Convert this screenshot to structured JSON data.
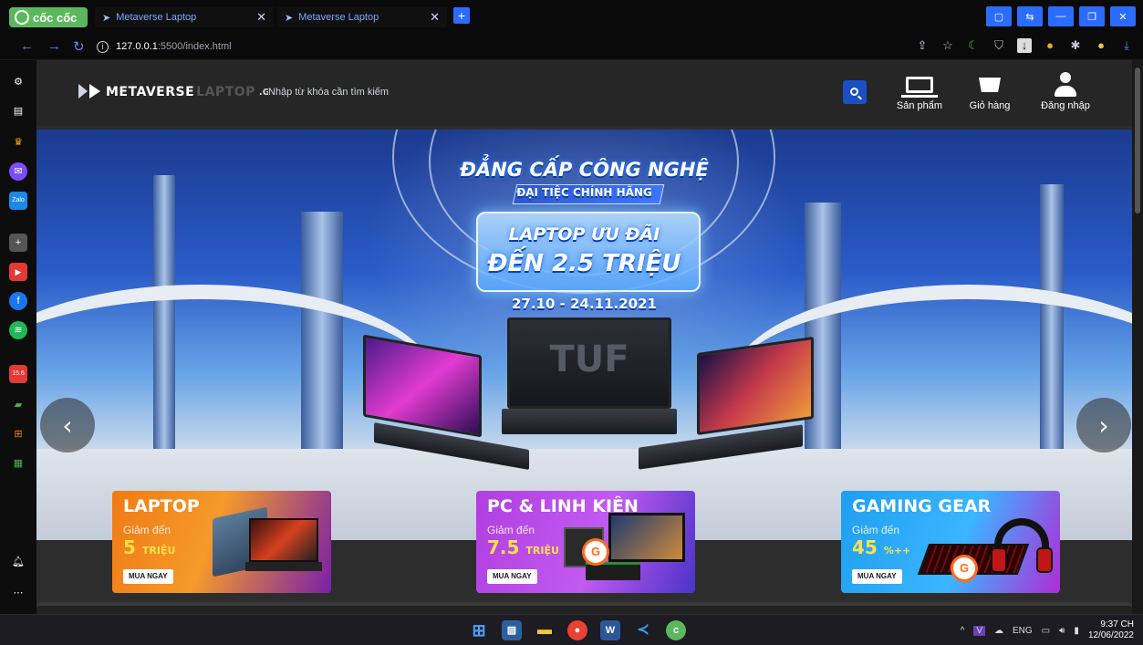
{
  "browser": {
    "brand": "cốc cốc",
    "tabs": [
      {
        "title": "Metaverse Laptop"
      },
      {
        "title": "Metaverse Laptop"
      }
    ],
    "url_host": "127.0.0.1",
    "url_path": ":5500/index.html"
  },
  "site": {
    "logo_a": "METAVERSE",
    "logo_b": "LAPTOP",
    "logo_c": ".GROUP1",
    "search_placeholder": "Nhập từ khóa cần tìm kiếm",
    "nav": [
      {
        "label": "Sản phẩm",
        "icon": "laptop-icon"
      },
      {
        "label": "Giỏ hàng",
        "icon": "cart-icon"
      },
      {
        "label": "Đăng nhập",
        "icon": "user-icon"
      }
    ]
  },
  "hero": {
    "line1": "ĐẲNG CẤP CÔNG NGHỆ",
    "line2": "ĐẠI TIỆC CHÍNH HÃNG",
    "line3": "LAPTOP ƯU ĐÃI",
    "line4": "ĐẾN 2.5 TRIỆU",
    "dates": "27.10 - 24.11.2021",
    "laptop_brand": "TUF"
  },
  "promos": [
    {
      "title": "LAPTOP",
      "sub": "Giảm đến",
      "amount": "5",
      "unit": "TRIỆU",
      "cta": "MUA NGAY"
    },
    {
      "title": "PC & LINH KIỆN",
      "sub": "Giảm đến",
      "amount": "7.5",
      "unit": "TRIỆU",
      "cta": "MUA NGAY"
    },
    {
      "title": "GAMING GEAR",
      "sub": "Giảm đến",
      "amount": "45",
      "unit": "%++",
      "cta": "MUA NGAY"
    }
  ],
  "sidebar": {
    "badge_text": "15.6"
  },
  "taskbar": {
    "lang": "ENG",
    "time": "9:37 CH",
    "date": "12/06/2022"
  },
  "colors": {
    "accent_blue": "#2b6cff",
    "search_button": "#1a4fc4",
    "coccoc_green": "#5cb85c"
  }
}
